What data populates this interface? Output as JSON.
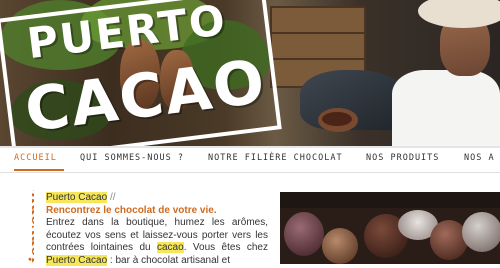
{
  "hero": {
    "logo_line1": "Puerto",
    "logo_line2": "Cacao"
  },
  "nav": {
    "items": [
      {
        "label": "ACCUEIL",
        "active": true
      },
      {
        "label": "QUI SOMMES-NOUS ?",
        "active": false
      },
      {
        "label": "NOTRE FILIÈRE CHOCOLAT",
        "active": false
      },
      {
        "label": "NOS PRODUITS",
        "active": false
      },
      {
        "label": "NOS A",
        "active": false
      }
    ]
  },
  "sidebar": {
    "heading": "Bienvenue"
  },
  "content": {
    "brand": "Puerto Cacao",
    "separator": "//",
    "tagline": "Rencontrez le chocolat de votre vie.",
    "body_part1": "Entrez dans la boutique, humez les arômes, écoutez vos sens et laissez-vous porter vers les contrées lointaines du ",
    "body_keyword": "cacao",
    "body_part2": ". Vous êtes chez ",
    "body_brand": "Puerto Cacao",
    "body_part3": " : bar à chocolat artisanal et"
  },
  "colors": {
    "accent": "#d06a1e",
    "highlight": "#f6e65a",
    "text": "#333333"
  }
}
